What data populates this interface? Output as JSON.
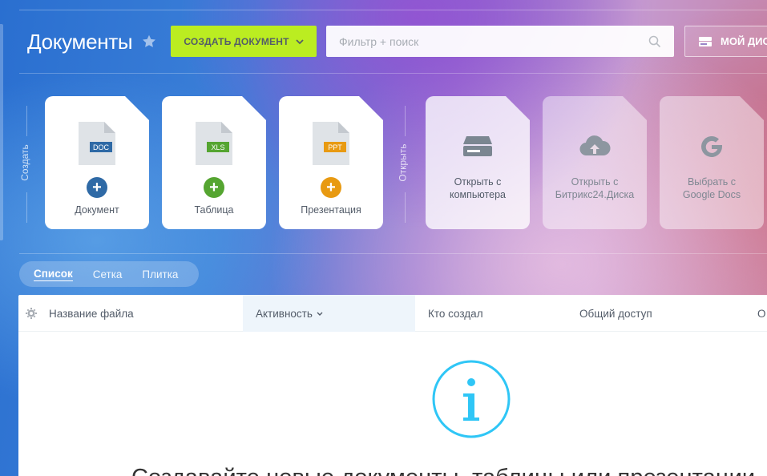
{
  "header": {
    "title": "Документы",
    "create_button": "СОЗДАТЬ ДОКУМЕНТ",
    "search_placeholder": "Фильтр + поиск",
    "disk_button": "МОЙ ДИС"
  },
  "create_section": {
    "label": "Создать",
    "cards": [
      {
        "ext": "DOC",
        "label": "Документ",
        "ext_color": "#2f6aa6",
        "plus_color": "#2f6aa6"
      },
      {
        "ext": "XLS",
        "label": "Таблица",
        "ext_color": "#55a531",
        "plus_color": "#55a531"
      },
      {
        "ext": "PPT",
        "label": "Презентация",
        "ext_color": "#e89a12",
        "plus_color": "#e89a12"
      }
    ]
  },
  "open_section": {
    "label": "Открыть",
    "cards": [
      {
        "icon": "hard-drive-icon",
        "line1": "Открыть с",
        "line2": "компьютера"
      },
      {
        "icon": "cloud-upload-icon",
        "line1": "Открыть с",
        "line2": "Битрикс24.Диска"
      },
      {
        "icon": "google-icon",
        "line1": "Выбрать с",
        "line2": "Google Docs"
      }
    ]
  },
  "view_switch": {
    "list": "Список",
    "grid": "Сетка",
    "tiles": "Плитка",
    "active": "list"
  },
  "grid": {
    "columns": {
      "name": "Название файла",
      "activity": "Активность",
      "created_by": "Кто создал",
      "shared": "Общий доступ",
      "last": "О"
    },
    "empty_text": "Создавайте новые документы, таблицы или презентации"
  },
  "colors": {
    "accent_green": "#bbed21",
    "info_blue": "#2fc6f6"
  }
}
